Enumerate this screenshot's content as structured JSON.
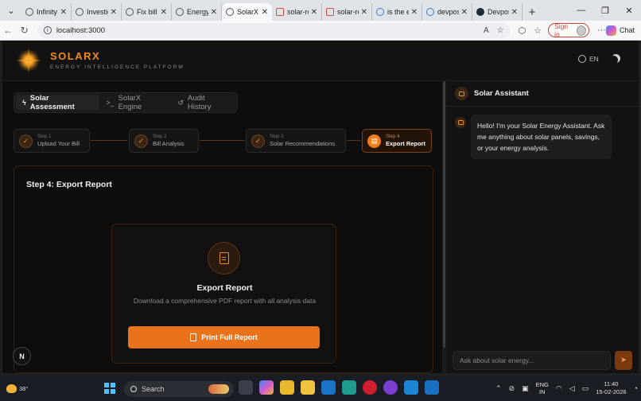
{
  "browser": {
    "tabs": [
      {
        "label": "Infinity",
        "icon": "github-icon"
      },
      {
        "label": "Investig",
        "icon": "page-icon"
      },
      {
        "label": "Fix bill a",
        "icon": "github-icon"
      },
      {
        "label": "Energy I",
        "icon": "globe-icon"
      },
      {
        "label": "SolarX",
        "icon": "globe-icon",
        "active": true
      },
      {
        "label": "solar-re",
        "icon": "pdf-icon"
      },
      {
        "label": "solar-re",
        "icon": "pdf-icon"
      },
      {
        "label": "is the el",
        "icon": "search-icon"
      },
      {
        "label": "devpost",
        "icon": "search-icon"
      },
      {
        "label": "Devpost",
        "icon": "devpost-icon"
      }
    ],
    "url": "localhost:3000",
    "signin_label": "Sign in",
    "chat_label": "Chat"
  },
  "app": {
    "brand": "SOLARX",
    "tagline": "ENERGY INTELLIGENCE PLATFORM",
    "language": "EN",
    "mode_tabs": [
      {
        "label": "Solar Assessment",
        "active": true
      },
      {
        "label": "SolarX Engine",
        "active": false
      },
      {
        "label": "Audit History",
        "active": false
      }
    ],
    "steps": [
      {
        "number": "Step 1",
        "title": "Upload Your Bill",
        "state": "done"
      },
      {
        "number": "Step 2",
        "title": "Bill Analysis",
        "state": "done"
      },
      {
        "number": "Step 3",
        "title": "Solar Recommendations",
        "state": "done"
      },
      {
        "number": "Step 4",
        "title": "Export Report",
        "state": "active"
      }
    ],
    "card_title": "Step 4: Export Report",
    "export": {
      "title": "Export Report",
      "description": "Download a comprehensive PDF report with all analysis data",
      "button_label": "Print Full Report"
    },
    "badge": "N",
    "assistant": {
      "title": "Solar Assistant",
      "message": "Hello! I'm your Solar Energy Assistant. Ask me anything about solar panels, savings, or your energy analysis.",
      "input_placeholder": "Ask about solar energy..."
    },
    "accent_color": "#f08a22"
  },
  "taskbar": {
    "temperature": "38°",
    "search_placeholder": "Search",
    "language": "ENG",
    "region": "IN",
    "time": "11:40",
    "date": "15-02-2026"
  }
}
